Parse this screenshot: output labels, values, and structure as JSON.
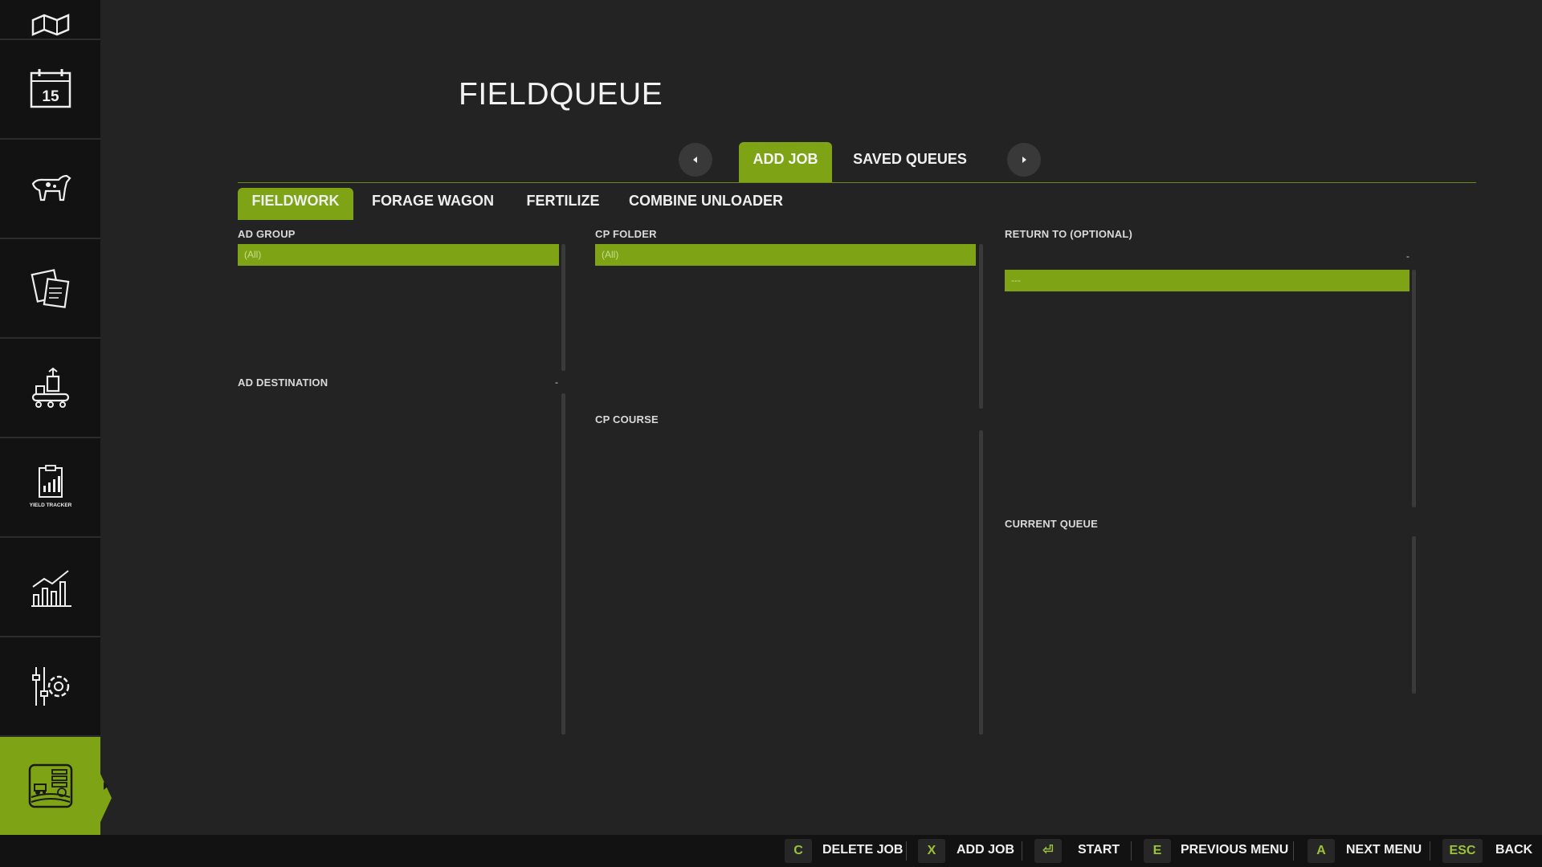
{
  "title": "FIELDQUEUE",
  "colors": {
    "accent": "#7ea314",
    "background": "#232323",
    "sidebar": "#121212",
    "key_text": "#9cc23a"
  },
  "sidebar": {
    "items": [
      {
        "name": "map-icon",
        "active": false
      },
      {
        "name": "calendar-icon",
        "label": "15",
        "active": false
      },
      {
        "name": "animals-icon",
        "active": false
      },
      {
        "name": "contracts-icon",
        "active": false
      },
      {
        "name": "production-icon",
        "active": false
      },
      {
        "name": "yield-tracker-icon",
        "label": "YIELD TRACKER",
        "active": false
      },
      {
        "name": "statistics-icon",
        "active": false
      },
      {
        "name": "settings-icon",
        "active": false
      },
      {
        "name": "fieldqueue-icon",
        "active": true
      }
    ]
  },
  "top_tabs": [
    {
      "label": "ADD JOB",
      "active": true
    },
    {
      "label": "SAVED QUEUES",
      "active": false
    }
  ],
  "sub_tabs": [
    {
      "label": "FIELDWORK",
      "active": true
    },
    {
      "label": "FORAGE WAGON",
      "active": false
    },
    {
      "label": "FERTILIZE",
      "active": false
    },
    {
      "label": "COMBINE UNLOADER",
      "active": false
    }
  ],
  "panels": {
    "ad_group": {
      "label": "AD GROUP",
      "rows": [
        "(All)"
      ]
    },
    "ad_destination": {
      "label": "AD DESTINATION",
      "value": "-"
    },
    "cp_folder": {
      "label": "CP FOLDER",
      "rows": [
        "(All)"
      ]
    },
    "cp_course": {
      "label": "CP COURSE"
    },
    "return_to": {
      "label": "RETURN TO (OPTIONAL)",
      "value": "-",
      "rows": [
        "---"
      ]
    },
    "current_queue": {
      "label": "CURRENT QUEUE"
    }
  },
  "bottom_bar": {
    "actions": [
      {
        "key": "C",
        "label": "DELETE JOB"
      },
      {
        "key": "X",
        "label": "ADD JOB"
      },
      {
        "key": "⏎",
        "label": "START"
      },
      {
        "key": "E",
        "label": "PREVIOUS MENU"
      },
      {
        "key": "A",
        "label": "NEXT MENU"
      },
      {
        "key": "ESC",
        "label": "BACK"
      }
    ]
  }
}
